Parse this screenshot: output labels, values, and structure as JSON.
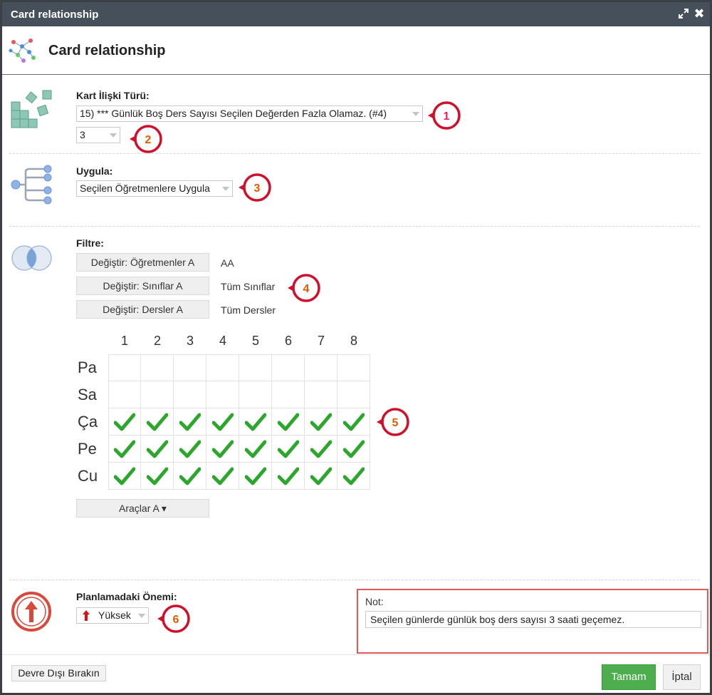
{
  "window": {
    "title": "Card relationship"
  },
  "header": {
    "title": "Card relationship"
  },
  "relation_type": {
    "label": "Kart İlişki Türü:",
    "selected": "15) *** Günlük Boş Ders Sayısı Seçilen Değerden Fazla Olamaz. (#4)",
    "value_selected": "3"
  },
  "apply": {
    "label": "Uygula:",
    "selected": "Seçilen Öğretmenlere Uygula"
  },
  "filter": {
    "label": "Filtre:",
    "rows": [
      {
        "button": "Değiştir: Öğretmenler A",
        "value": "AA"
      },
      {
        "button": "Değiştir: Sınıflar A",
        "value": "Tüm Sınıflar"
      },
      {
        "button": "Değiştir: Dersler A",
        "value": "Tüm Dersler"
      }
    ]
  },
  "grid": {
    "columns": [
      "1",
      "2",
      "3",
      "4",
      "5",
      "6",
      "7",
      "8"
    ],
    "rows": [
      {
        "day": "Pa",
        "checked": [
          false,
          false,
          false,
          false,
          false,
          false,
          false,
          false
        ]
      },
      {
        "day": "Sa",
        "checked": [
          false,
          false,
          false,
          false,
          false,
          false,
          false,
          false
        ]
      },
      {
        "day": "Ça",
        "checked": [
          true,
          true,
          true,
          true,
          true,
          true,
          true,
          true
        ]
      },
      {
        "day": "Pe",
        "checked": [
          true,
          true,
          true,
          true,
          true,
          true,
          true,
          true
        ]
      },
      {
        "day": "Cu",
        "checked": [
          true,
          true,
          true,
          true,
          true,
          true,
          true,
          true
        ]
      }
    ],
    "tools_button": "Araçlar A ▾"
  },
  "importance": {
    "label": "Planlamadaki Önemi:",
    "selected": "Yüksek"
  },
  "note": {
    "label": "Not:",
    "value": "Seçilen günlerde günlük boş ders sayısı 3 saati geçemez."
  },
  "badges": [
    "1",
    "2",
    "3",
    "4",
    "5",
    "6"
  ],
  "footer": {
    "disable_button": "Devre Dışı Bırakın",
    "ok_button": "Tamam",
    "cancel_button": "İptal"
  },
  "colors": {
    "titlebar": "#46505a",
    "badge_red": "#d0102a",
    "check_green": "#2ca62c",
    "ok_green": "#4cae4c",
    "note_border": "#e05a5a"
  }
}
